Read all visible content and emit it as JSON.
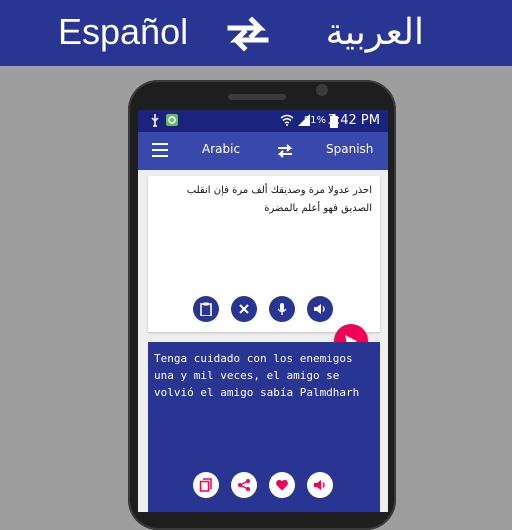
{
  "banner": {
    "left_language": "Español",
    "right_language": "العربية",
    "swap_icon": "swap-horizontal-icon"
  },
  "statusbar": {
    "battery_percent": "81%",
    "time": "3:42 PM"
  },
  "appbar": {
    "source_language": "Arabic",
    "target_language": "Spanish"
  },
  "input": {
    "text": "احذر عدولا مرة وصديقك ألف مرة فإن انقلب الصديق فهو أعلم بالمضرة"
  },
  "output": {
    "text": "Tenga cuidado con los enemigos una y mil veces, el amigo se volvió el amigo sabía Palmdharh"
  },
  "colors": {
    "primary_dark": "#1a237e",
    "primary": "#3949ab",
    "banner": "#283593",
    "accent": "#f50057"
  }
}
